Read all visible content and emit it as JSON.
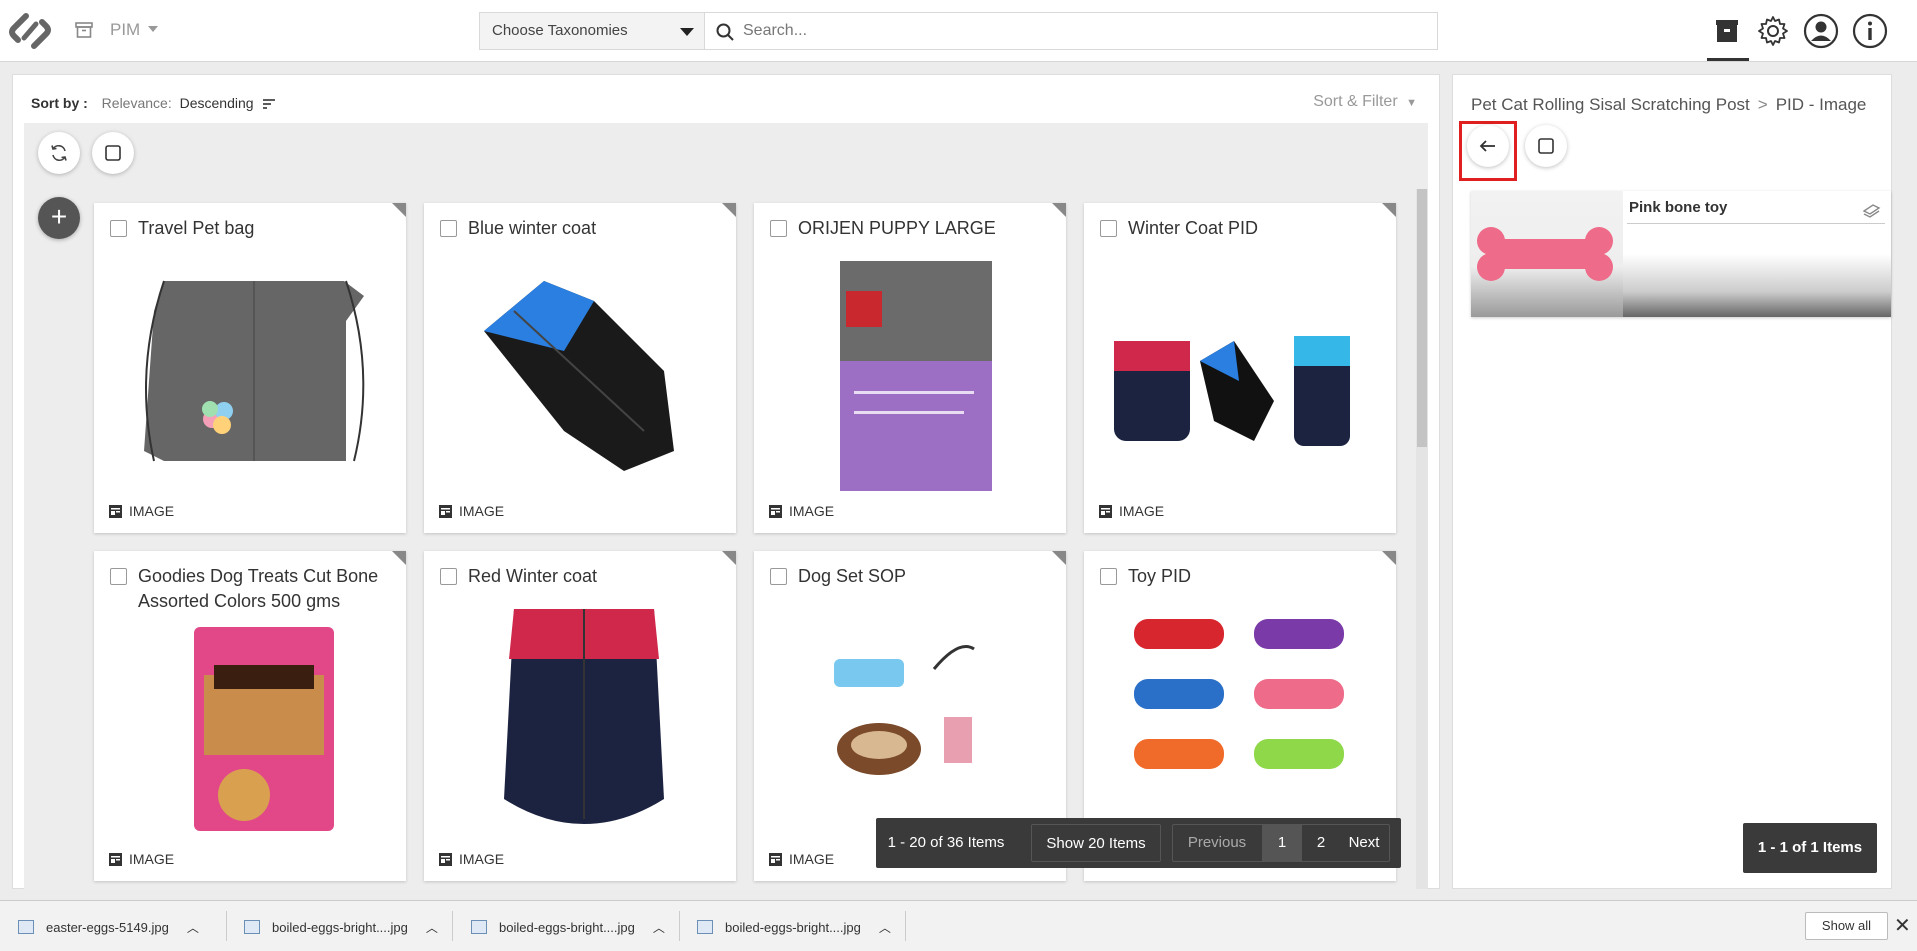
{
  "header": {
    "app_name": "PIM",
    "taxonomy_select": "Choose Taxonomies",
    "search_placeholder": "Search..."
  },
  "toolbar": {
    "sort_by_label": "Sort by :",
    "relevance_label": "Relevance:",
    "relevance_value": "Descending",
    "sort_filter_label": "Sort & Filter"
  },
  "cards": [
    {
      "title": "Travel Pet bag",
      "type": "IMAGE"
    },
    {
      "title": "Blue winter coat",
      "type": "IMAGE"
    },
    {
      "title": "ORIJEN PUPPY LARGE",
      "type": "IMAGE"
    },
    {
      "title": "Winter Coat PID",
      "type": "IMAGE"
    },
    {
      "title": "Goodies Dog Treats Cut Bone Assorted Colors 500 gms",
      "type": "IMAGE"
    },
    {
      "title": "Red Winter coat",
      "type": "IMAGE"
    },
    {
      "title": "Dog Set SOP",
      "type": "IMAGE"
    },
    {
      "title": "Toy PID",
      "type": "IMAGE"
    }
  ],
  "pager": {
    "range": "1 - 20 of 36 Items",
    "show": "Show 20 Items",
    "previous": "Previous",
    "page1": "1",
    "page2": "2",
    "next": "Next"
  },
  "detail": {
    "crumb_parent": "Pet Cat Rolling Sisal Scratching Post",
    "crumb_sep": ">",
    "crumb_current": "PID - Image",
    "item_title": "Pink bone toy",
    "count": "1 - 1 of 1 Items"
  },
  "downloads": {
    "files": [
      "easter-eggs-5149.jpg",
      "boiled-eggs-bright....jpg",
      "boiled-eggs-bright....jpg",
      "boiled-eggs-bright....jpg"
    ],
    "show_all": "Show all",
    "close": "✕"
  },
  "colors": {
    "accent_dark": "#3a3a3a",
    "highlight": "#e02020",
    "pink_toy": "#ee6b8a"
  }
}
